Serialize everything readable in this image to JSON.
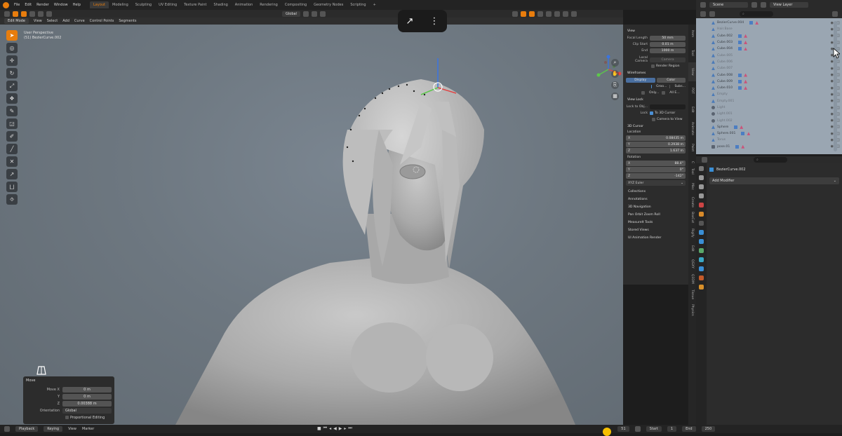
{
  "menu": {
    "items": [
      "File",
      "Edit",
      "Render",
      "Window",
      "Help"
    ],
    "tabs": [
      "Layout",
      "Modeling",
      "Sculpting",
      "UV Editing",
      "Texture Paint",
      "Shading",
      "Animation",
      "Rendering",
      "Compositing",
      "Geometry Nodes",
      "Scripting"
    ],
    "active_tab": "Layout",
    "add_tab": "+"
  },
  "header": {
    "mode": "Edit Mode",
    "menus": [
      "View",
      "Select",
      "Add",
      "Curve",
      "Control Points",
      "Segments"
    ],
    "orientation": "Global"
  },
  "viewport": {
    "perspective": "User Perspective",
    "object": "(51) BezierCurve.002"
  },
  "overlay": {
    "share_icon": "↗",
    "more_icon": "⋮"
  },
  "toolbar": {
    "tools": [
      "➤",
      "◎",
      "✛",
      "↻",
      "⤢",
      "❖",
      "✎",
      "◲",
      "✐",
      "╱",
      "✕",
      "↗",
      "⨆",
      "⯑"
    ]
  },
  "move_panel": {
    "title": "Move",
    "fields": [
      {
        "label": "Move X",
        "value": "0 m"
      },
      {
        "label": "Y",
        "value": "0 m"
      },
      {
        "label": "Z",
        "value": "0.00388 m"
      }
    ],
    "orientation_label": "Orientation",
    "orientation_value": "Global",
    "proportional": "Proportional Editing"
  },
  "npanel": {
    "view_title": "View",
    "focal_length_label": "Focal Length",
    "focal_length": "50 mm",
    "clip_start_label": "Clip Start",
    "clip_start": "0.01 m",
    "end_label": "End",
    "end": "1000 m",
    "local_camera_label": "Local Camera",
    "local_camera": "Camera",
    "render_region": "Render Region",
    "wireframes_label": "Wireframes",
    "wf_display": "Display",
    "wf_color": "Color",
    "wf_options": [
      "Groo...",
      "Subs...",
      "Only...",
      "All E..."
    ],
    "view_lock_title": "View Lock",
    "lock_to_obj_label": "Lock to Obj...",
    "lock_label": "Lock",
    "to_3d_cursor": "To 3D Cursor",
    "camera_to_view": "Camera to View",
    "cursor_title": "3D Cursor",
    "location_label": "Location",
    "location": [
      {
        "axis": "X",
        "value": "0.08435 m"
      },
      {
        "axis": "Y",
        "value": "0.2938 m"
      },
      {
        "axis": "Z",
        "value": "1.637 m"
      }
    ],
    "rotation_label": "Rotation",
    "rotation": [
      {
        "axis": "X",
        "value": "88.4°"
      },
      {
        "axis": "Y",
        "value": "0°"
      },
      {
        "axis": "Z",
        "value": "-142°"
      }
    ],
    "rotation_mode": "XYZ Euler",
    "collapsed": [
      "Collections",
      "Annotations",
      "3D Navigation",
      "Pan Orbit Zoom Roll",
      "MeasureIt Tools",
      "Stored Views",
      "UI Animation Render"
    ],
    "tabs": [
      "Item",
      "Tool",
      "View",
      "PDT",
      "Edit",
      "Animate",
      "Paint",
      "Create Proxy"
    ]
  },
  "outliner": {
    "scene": "Scene",
    "view_layer": "View Layer",
    "search_placeholder": "",
    "rows": [
      {
        "name": "BezierCurve.004",
        "type": "curve",
        "dim": false
      },
      {
        "name": "Hair.Base",
        "type": "mesh",
        "dim": true
      },
      {
        "name": "Cube.002",
        "type": "mesh",
        "dim": false
      },
      {
        "name": "Cube.003",
        "type": "mesh",
        "dim": false
      },
      {
        "name": "Cube.004",
        "type": "mesh",
        "dim": false
      },
      {
        "name": "Cube.005",
        "type": "mesh",
        "dim": true
      },
      {
        "name": "Cube.006",
        "type": "mesh",
        "dim": true
      },
      {
        "name": "Cube.007",
        "type": "mesh",
        "dim": true
      },
      {
        "name": "Cube.008",
        "type": "mesh",
        "dim": false
      },
      {
        "name": "Cube.009",
        "type": "mesh",
        "dim": false
      },
      {
        "name": "Cube.010",
        "type": "mesh",
        "dim": false
      },
      {
        "name": "Empty",
        "type": "mesh",
        "dim": true
      },
      {
        "name": "Empty.001",
        "type": "mesh",
        "dim": true
      },
      {
        "name": "Light",
        "type": "light",
        "dim": true
      },
      {
        "name": "Light.001",
        "type": "light",
        "dim": true
      },
      {
        "name": "Light.002",
        "type": "light",
        "dim": true
      },
      {
        "name": "Sphere",
        "type": "mesh",
        "dim": false
      },
      {
        "name": "Sphere.001",
        "type": "mesh",
        "dim": false
      },
      {
        "name": "Torus",
        "type": "mesh",
        "dim": true
      },
      {
        "name": "pose.01",
        "type": "cam",
        "dim": false
      }
    ]
  },
  "properties": {
    "object_name": "BezierCurve.002",
    "add_modifier": "Add Modifier",
    "side_tabs": [
      "Tool",
      "Misc",
      "Create",
      "BoxCut",
      "Rigify",
      "Edit",
      "QGXY",
      "Q3DM",
      "Tissue",
      "Physics"
    ]
  },
  "status": {
    "playback": "Playback",
    "keying": "Keying",
    "view": "View",
    "marker": "Marker",
    "frame": "51",
    "start_label": "Start",
    "start": "1",
    "end_label": "End",
    "end": "250"
  },
  "colors": {
    "accent": "#e87d0d",
    "outliner_bg": "#9aa6b2",
    "viewport_bg": "#6d7780"
  }
}
